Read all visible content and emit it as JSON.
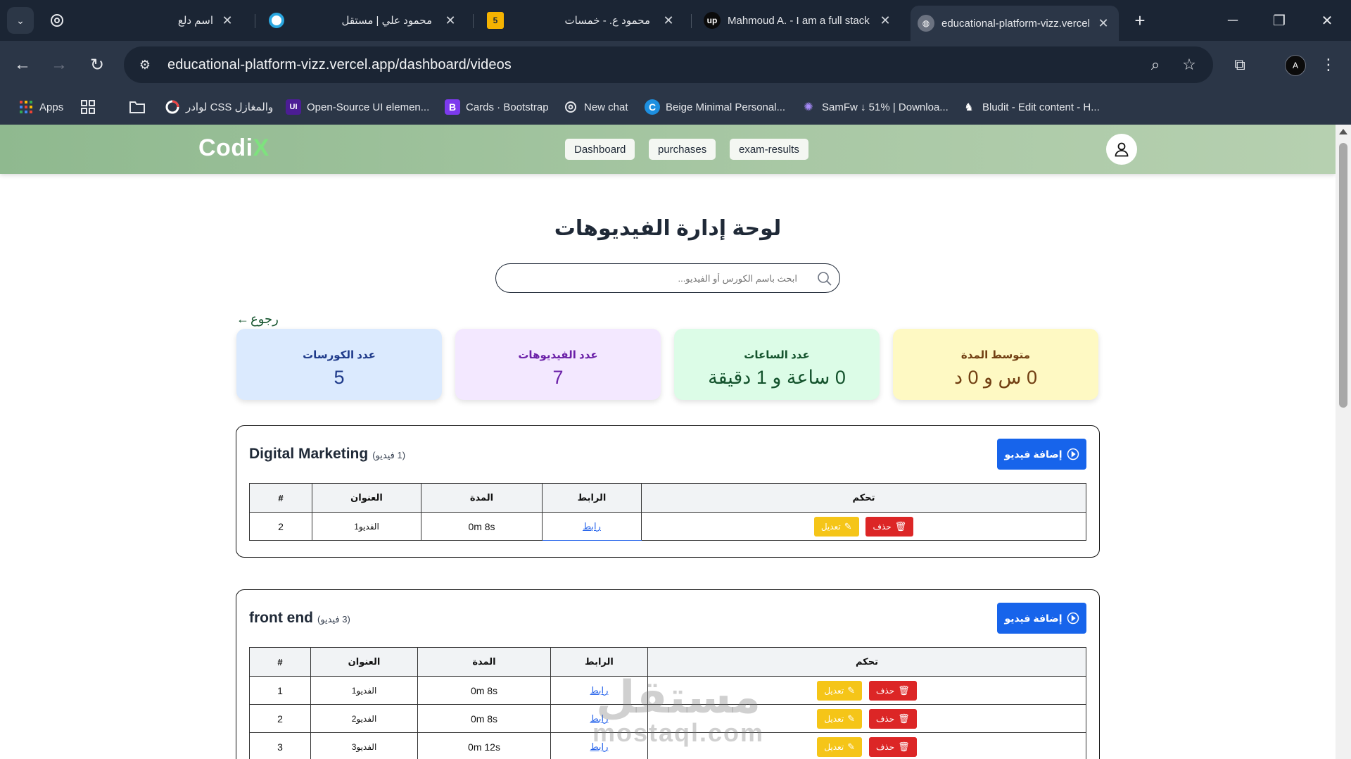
{
  "browser": {
    "tabs": [
      {
        "title": "اسم دلع",
        "icon": "circle-o-icon"
      },
      {
        "title": "محمود علي | مستقل",
        "icon": "mostaql-icon"
      },
      {
        "title": "محمود ع. - خمسات",
        "icon": "khamsat-icon",
        "favicon_text": "5"
      },
      {
        "title": "Mahmoud A. - I am a full stack",
        "icon": "upwork-icon",
        "favicon_text": "up"
      },
      {
        "title": "educational-platform-vizz.vercel",
        "icon": "globe-icon",
        "active": true
      }
    ],
    "url": "educational-platform-vizz.vercel.app/dashboard/videos",
    "profile_initials": "A",
    "bookmarks": [
      {
        "label": "Apps",
        "icon": "apps-grid-icon"
      },
      {
        "label": "لوادر CSS والمغازل",
        "icon": "loader-ring-icon"
      },
      {
        "label": "Open-Source UI elemen...",
        "icon": "uiverse-icon",
        "icon_text": "UI"
      },
      {
        "label": "Cards · Bootstrap",
        "icon": "bootstrap-icon",
        "icon_text": "B"
      },
      {
        "label": "New chat",
        "icon": "chatgpt-icon"
      },
      {
        "label": "Beige Minimal Personal...",
        "icon": "canva-icon",
        "icon_text": "C"
      },
      {
        "label": "SamFw ↓ 51% | Downloa...",
        "icon": "samfw-icon"
      },
      {
        "label": "Bludit - Edit content - H...",
        "icon": "bludit-icon"
      }
    ]
  },
  "site": {
    "brand": "Codi",
    "brand_accent": "X",
    "nav": [
      "Dashboard",
      "purchases",
      "exam-results"
    ]
  },
  "page": {
    "title": "لوحة إدارة الفيديوهات",
    "search_placeholder": "ابحث باسم الكورس أو الفيديو...",
    "back_label": "رجوع"
  },
  "stats": [
    {
      "label": "عدد الكورسات",
      "value": "5",
      "bg": "#dbeafe",
      "color": "#1e3a8a",
      "value_color": "#1e3a8a"
    },
    {
      "label": "عدد الفيديوهات",
      "value": "7",
      "bg": "#f3e8ff",
      "color": "#6b21a8",
      "value_color": "#6b21a8"
    },
    {
      "label": "عدد الساعات",
      "value": "0 ساعة و 1 دقيقة",
      "bg": "#dcfce7",
      "color": "#14532d",
      "value_color": "#14532d"
    },
    {
      "label": "متوسط المدة",
      "value": "0 س و 0 د",
      "bg": "#fef9c3",
      "color": "#713f12",
      "value_color": "#713f12"
    }
  ],
  "table_headers": {
    "num": "#",
    "title": "العنوان",
    "duration": "المدة",
    "link": "الرابط",
    "controls": "تحكم"
  },
  "labels": {
    "add_video": "إضافة فيديو",
    "delete": "حذف",
    "edit": "تعديل",
    "link": "رابط"
  },
  "courses": [
    {
      "name": "Digital Marketing",
      "count": "(1 فيديو)",
      "videos": [
        {
          "num": "2",
          "title": "الفديو1",
          "duration": "0m 8s"
        }
      ]
    },
    {
      "name": "front end",
      "count": "(3 فيديو)",
      "videos": [
        {
          "num": "1",
          "title": "الفديو1",
          "duration": "0m 8s"
        },
        {
          "num": "2",
          "title": "الفديو2",
          "duration": "0m 8s"
        },
        {
          "num": "3",
          "title": "الفديو3",
          "duration": "0m 12s"
        }
      ]
    }
  ],
  "watermark": {
    "arabic": "مستقل",
    "latin": "mostaql.com"
  },
  "colors": {
    "accent_blue": "#1764eb",
    "delete_red": "#dc2626",
    "edit_yellow": "#f5c518",
    "navbar_green": "#a9c8a5"
  }
}
